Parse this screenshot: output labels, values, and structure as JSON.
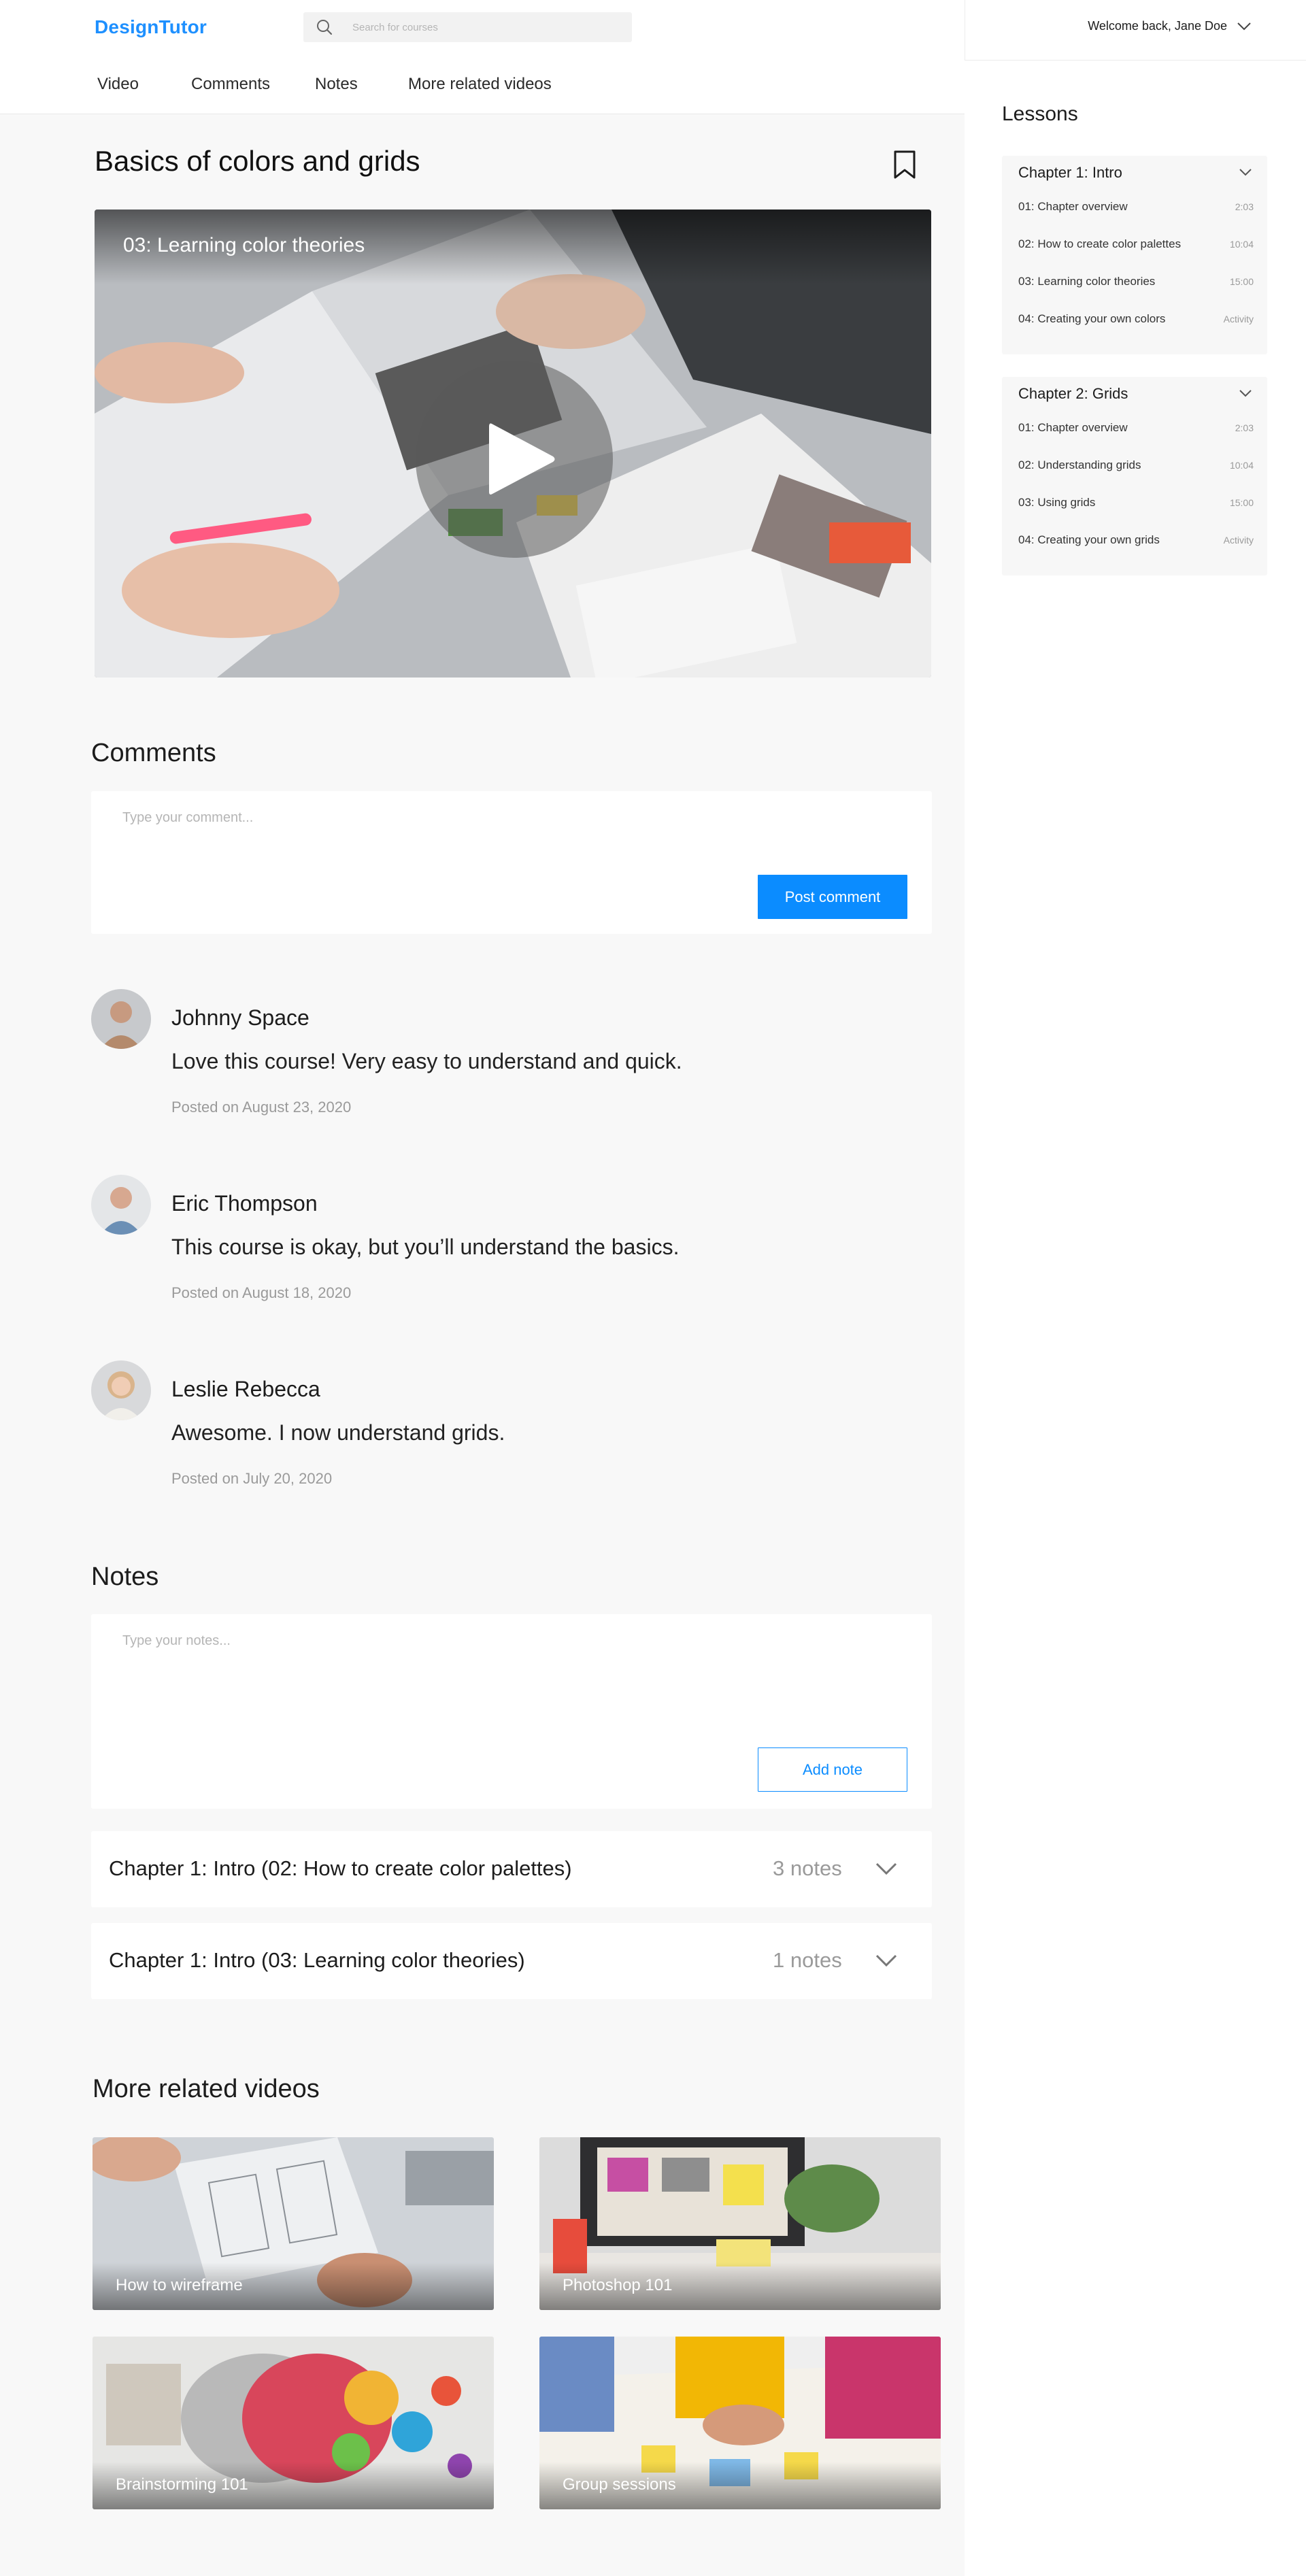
{
  "app": {
    "logo": "DesignTutor"
  },
  "search": {
    "placeholder": "Search for courses"
  },
  "user": {
    "greeting": "Welcome back, Jane Doe"
  },
  "subnav": {
    "tabs": [
      "Video",
      "Comments",
      "Notes",
      "More related videos"
    ]
  },
  "page": {
    "title": "Basics of colors and grids"
  },
  "video": {
    "caption": "03: Learning color theories"
  },
  "comments_section": {
    "title": "Comments",
    "placeholder": "Type your comment...",
    "post_label": "Post comment",
    "items": [
      {
        "name": "Johnny Space",
        "text": "Love this course! Very easy to understand and quick.",
        "date": "Posted on August 23, 2020"
      },
      {
        "name": "Eric Thompson",
        "text": "This course is okay, but you’ll understand the basics.",
        "date": "Posted on August 18, 2020"
      },
      {
        "name": "Leslie Rebecca",
        "text": "Awesome. I now understand grids.",
        "date": "Posted on July 20, 2020"
      }
    ]
  },
  "notes_section": {
    "title": "Notes",
    "placeholder": "Type your notes...",
    "add_label": "Add note",
    "groups": [
      {
        "label": "Chapter 1: Intro (02: How to create color palettes)",
        "count": "3 notes"
      },
      {
        "label": "Chapter 1: Intro (03: Learning color theories)",
        "count": "1 notes"
      }
    ]
  },
  "related": {
    "title": "More related videos",
    "videos": [
      {
        "caption": "How to wireframe"
      },
      {
        "caption": "Photoshop 101"
      },
      {
        "caption": "Brainstorming 101"
      },
      {
        "caption": "Group sessions"
      }
    ]
  },
  "sidebar": {
    "title": "Lessons",
    "chapters": [
      {
        "title": "Chapter 1: Intro",
        "lessons": [
          {
            "label": "01: Chapter overview",
            "meta": "2:03"
          },
          {
            "label": "02: How to create color palettes",
            "meta": "10:04"
          },
          {
            "label": "03: Learning color theories",
            "meta": "15:00"
          },
          {
            "label": "04: Creating your own colors",
            "meta": "Activity"
          }
        ]
      },
      {
        "title": "Chapter 2: Grids",
        "lessons": [
          {
            "label": "01: Chapter overview",
            "meta": "2:03"
          },
          {
            "label": "02: Understanding grids",
            "meta": "10:04"
          },
          {
            "label": "03: Using grids",
            "meta": "15:00"
          },
          {
            "label": "04: Creating your own grids",
            "meta": "Activity"
          }
        ]
      }
    ]
  },
  "colors": {
    "accent": "#0b8cff",
    "logo": "#1e90ff",
    "background": "#f8f8f8"
  }
}
